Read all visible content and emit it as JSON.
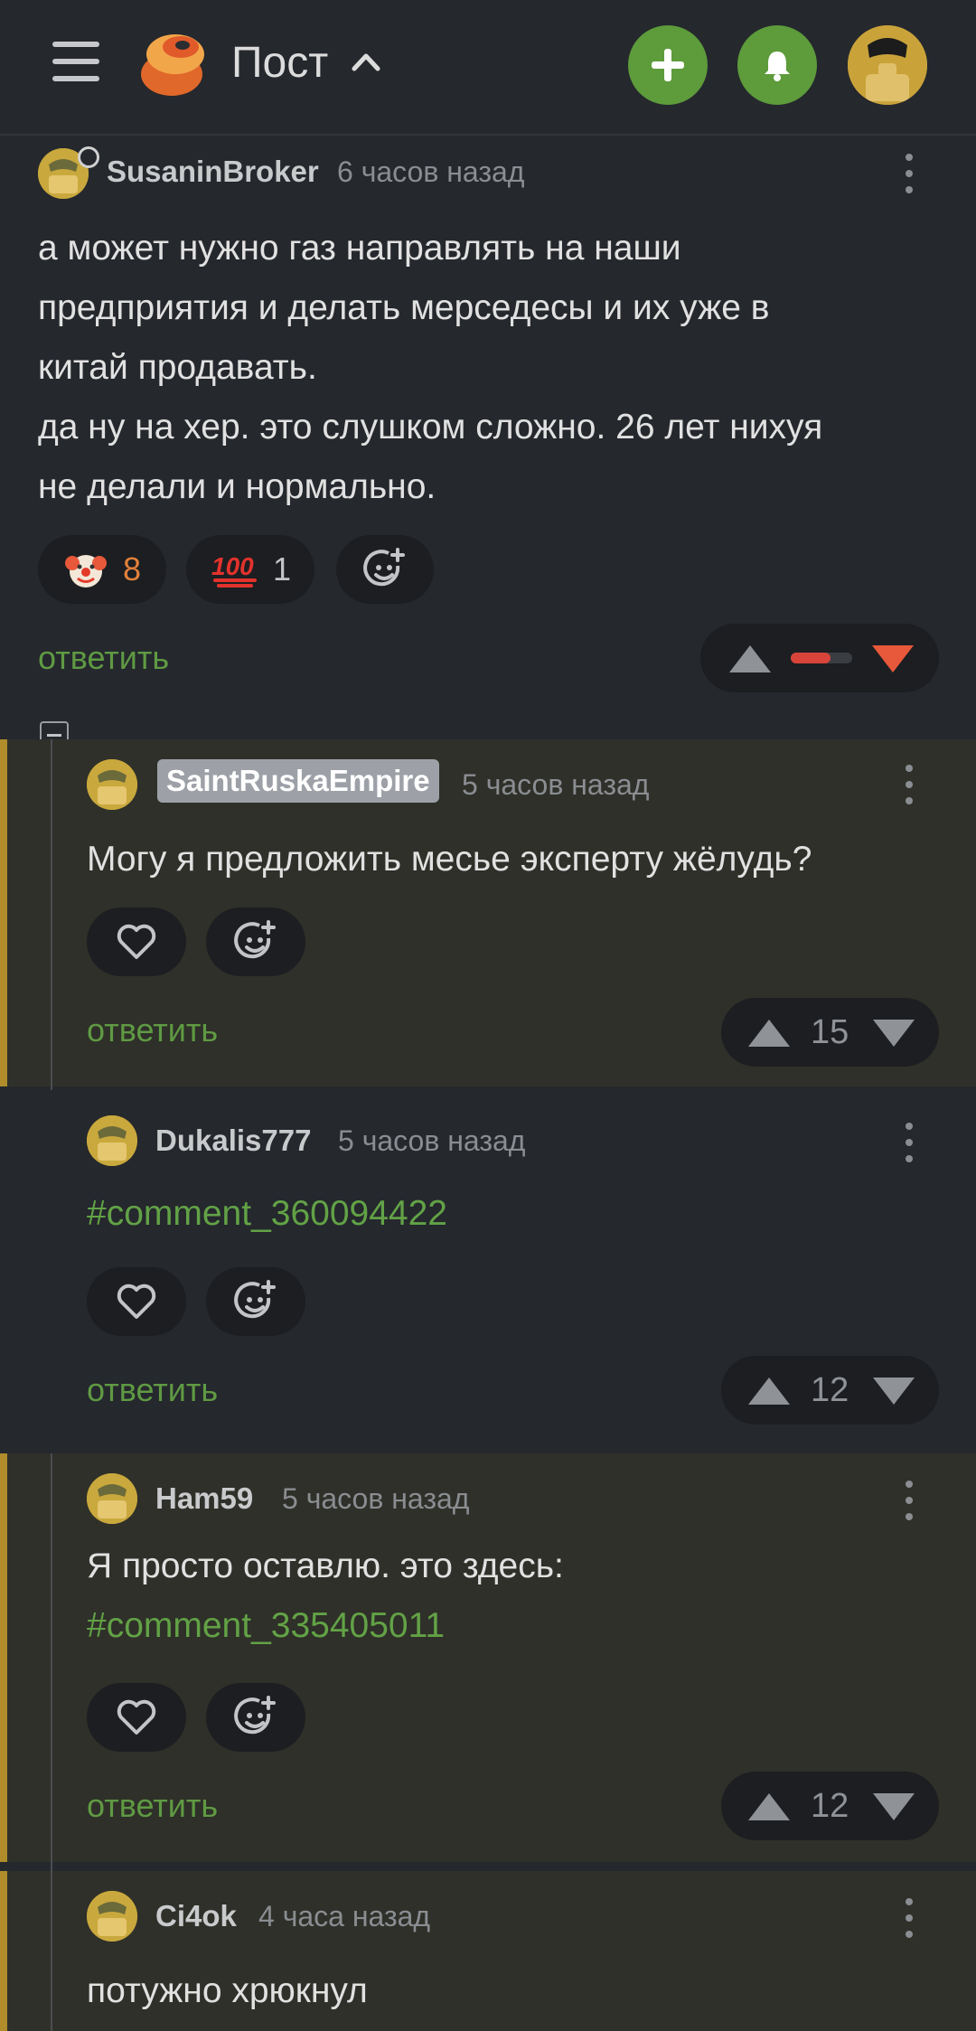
{
  "header": {
    "title": "Пост",
    "add_icon": "plus-icon",
    "bell_icon": "bell-icon",
    "accent": "#5d9b3b"
  },
  "comments": [
    {
      "author": "SusaninBroker",
      "time": "6 часов назад",
      "lines": [
        "а может нужно газ направлять на наши",
        "предприятия и делать мерседесы и их уже в",
        "китай продавать.",
        "да ну на хер. это слушком сложно. 26 лет нихуя",
        "не делали и нормально."
      ],
      "reactions": [
        {
          "icon": "clown-emoji",
          "count": "8"
        },
        {
          "icon": "hundred-emoji",
          "count": "1"
        }
      ],
      "reply": "ответить"
    },
    {
      "author": "SaintRuskaEmpire",
      "time": "5 часов назад",
      "lines": [
        "Могу я предложить месье эксперту жёлудь?"
      ],
      "reply": "ответить",
      "votes": "15"
    },
    {
      "author": "Dukalis777",
      "time": "5 часов назад",
      "link": "#comment_360094422",
      "reply": "ответить",
      "votes": "12"
    },
    {
      "author": "Ham59",
      "time": "5 часов назад",
      "lines": [
        "Я просто оставлю. это здесь:"
      ],
      "link": "#comment_335405011",
      "reply": "ответить",
      "votes": "12"
    },
    {
      "author": "Ci4ok",
      "time": "4 часа назад",
      "lines": [
        "потужно хрюкнул"
      ]
    }
  ]
}
